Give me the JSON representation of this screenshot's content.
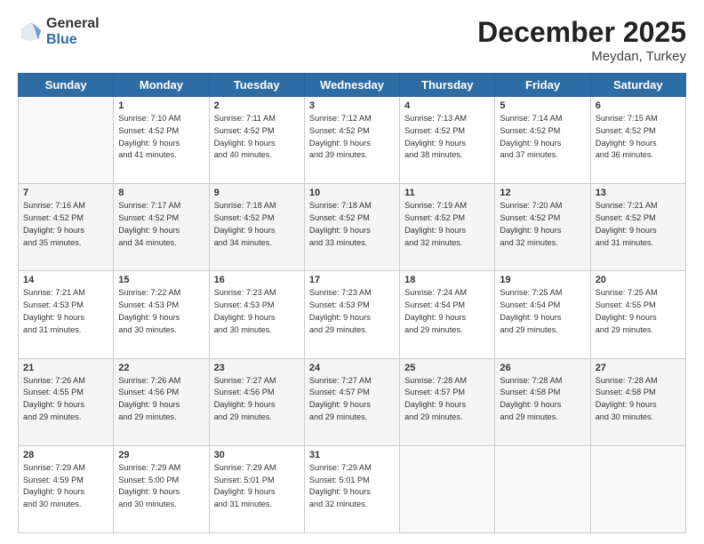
{
  "logo": {
    "general": "General",
    "blue": "Blue"
  },
  "title": {
    "month_year": "December 2025",
    "location": "Meydan, Turkey"
  },
  "days_of_week": [
    "Sunday",
    "Monday",
    "Tuesday",
    "Wednesday",
    "Thursday",
    "Friday",
    "Saturday"
  ],
  "weeks": [
    [
      {
        "day": "",
        "info": ""
      },
      {
        "day": "1",
        "info": "Sunrise: 7:10 AM\nSunset: 4:52 PM\nDaylight: 9 hours\nand 41 minutes."
      },
      {
        "day": "2",
        "info": "Sunrise: 7:11 AM\nSunset: 4:52 PM\nDaylight: 9 hours\nand 40 minutes."
      },
      {
        "day": "3",
        "info": "Sunrise: 7:12 AM\nSunset: 4:52 PM\nDaylight: 9 hours\nand 39 minutes."
      },
      {
        "day": "4",
        "info": "Sunrise: 7:13 AM\nSunset: 4:52 PM\nDaylight: 9 hours\nand 38 minutes."
      },
      {
        "day": "5",
        "info": "Sunrise: 7:14 AM\nSunset: 4:52 PM\nDaylight: 9 hours\nand 37 minutes."
      },
      {
        "day": "6",
        "info": "Sunrise: 7:15 AM\nSunset: 4:52 PM\nDaylight: 9 hours\nand 36 minutes."
      }
    ],
    [
      {
        "day": "7",
        "info": "Sunrise: 7:16 AM\nSunset: 4:52 PM\nDaylight: 9 hours\nand 35 minutes."
      },
      {
        "day": "8",
        "info": "Sunrise: 7:17 AM\nSunset: 4:52 PM\nDaylight: 9 hours\nand 34 minutes."
      },
      {
        "day": "9",
        "info": "Sunrise: 7:18 AM\nSunset: 4:52 PM\nDaylight: 9 hours\nand 34 minutes."
      },
      {
        "day": "10",
        "info": "Sunrise: 7:18 AM\nSunset: 4:52 PM\nDaylight: 9 hours\nand 33 minutes."
      },
      {
        "day": "11",
        "info": "Sunrise: 7:19 AM\nSunset: 4:52 PM\nDaylight: 9 hours\nand 32 minutes."
      },
      {
        "day": "12",
        "info": "Sunrise: 7:20 AM\nSunset: 4:52 PM\nDaylight: 9 hours\nand 32 minutes."
      },
      {
        "day": "13",
        "info": "Sunrise: 7:21 AM\nSunset: 4:52 PM\nDaylight: 9 hours\nand 31 minutes."
      }
    ],
    [
      {
        "day": "14",
        "info": "Sunrise: 7:21 AM\nSunset: 4:53 PM\nDaylight: 9 hours\nand 31 minutes."
      },
      {
        "day": "15",
        "info": "Sunrise: 7:22 AM\nSunset: 4:53 PM\nDaylight: 9 hours\nand 30 minutes."
      },
      {
        "day": "16",
        "info": "Sunrise: 7:23 AM\nSunset: 4:53 PM\nDaylight: 9 hours\nand 30 minutes."
      },
      {
        "day": "17",
        "info": "Sunrise: 7:23 AM\nSunset: 4:53 PM\nDaylight: 9 hours\nand 29 minutes."
      },
      {
        "day": "18",
        "info": "Sunrise: 7:24 AM\nSunset: 4:54 PM\nDaylight: 9 hours\nand 29 minutes."
      },
      {
        "day": "19",
        "info": "Sunrise: 7:25 AM\nSunset: 4:54 PM\nDaylight: 9 hours\nand 29 minutes."
      },
      {
        "day": "20",
        "info": "Sunrise: 7:25 AM\nSunset: 4:55 PM\nDaylight: 9 hours\nand 29 minutes."
      }
    ],
    [
      {
        "day": "21",
        "info": "Sunrise: 7:26 AM\nSunset: 4:55 PM\nDaylight: 9 hours\nand 29 minutes."
      },
      {
        "day": "22",
        "info": "Sunrise: 7:26 AM\nSunset: 4:56 PM\nDaylight: 9 hours\nand 29 minutes."
      },
      {
        "day": "23",
        "info": "Sunrise: 7:27 AM\nSunset: 4:56 PM\nDaylight: 9 hours\nand 29 minutes."
      },
      {
        "day": "24",
        "info": "Sunrise: 7:27 AM\nSunset: 4:57 PM\nDaylight: 9 hours\nand 29 minutes."
      },
      {
        "day": "25",
        "info": "Sunrise: 7:28 AM\nSunset: 4:57 PM\nDaylight: 9 hours\nand 29 minutes."
      },
      {
        "day": "26",
        "info": "Sunrise: 7:28 AM\nSunset: 4:58 PM\nDaylight: 9 hours\nand 29 minutes."
      },
      {
        "day": "27",
        "info": "Sunrise: 7:28 AM\nSunset: 4:58 PM\nDaylight: 9 hours\nand 30 minutes."
      }
    ],
    [
      {
        "day": "28",
        "info": "Sunrise: 7:29 AM\nSunset: 4:59 PM\nDaylight: 9 hours\nand 30 minutes."
      },
      {
        "day": "29",
        "info": "Sunrise: 7:29 AM\nSunset: 5:00 PM\nDaylight: 9 hours\nand 30 minutes."
      },
      {
        "day": "30",
        "info": "Sunrise: 7:29 AM\nSunset: 5:01 PM\nDaylight: 9 hours\nand 31 minutes."
      },
      {
        "day": "31",
        "info": "Sunrise: 7:29 AM\nSunset: 5:01 PM\nDaylight: 9 hours\nand 32 minutes."
      },
      {
        "day": "",
        "info": ""
      },
      {
        "day": "",
        "info": ""
      },
      {
        "day": "",
        "info": ""
      }
    ]
  ]
}
